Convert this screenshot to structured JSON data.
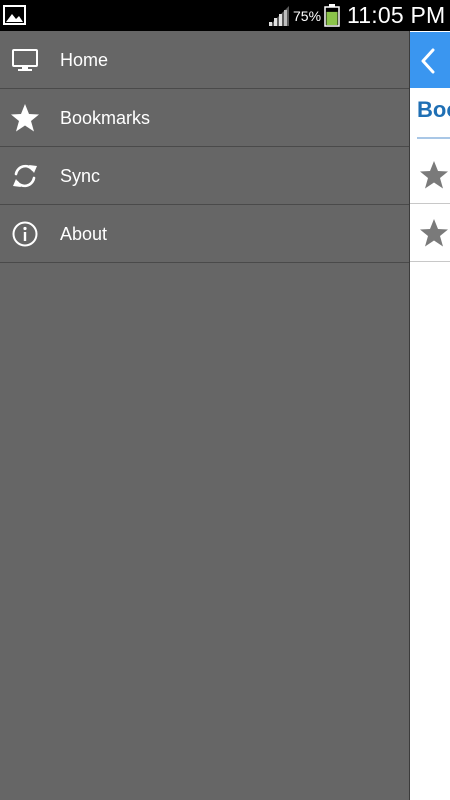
{
  "status_bar": {
    "battery_percent": "75%",
    "time": "11:05 PM",
    "left_icon": "image-icon",
    "signal_icon": "signal-icon",
    "battery_icon": "battery-icon",
    "battery_level": 0.75,
    "battery_color": "#8bc34a"
  },
  "drawer": {
    "background": "#666666",
    "items": [
      {
        "label": "Home",
        "icon": "monitor-icon"
      },
      {
        "label": "Bookmarks",
        "icon": "star-icon"
      },
      {
        "label": "Sync",
        "icon": "sync-icon"
      },
      {
        "label": "About",
        "icon": "info-icon"
      }
    ]
  },
  "main": {
    "header_color": "#3a96f0",
    "back_icon": "chevron-left-icon",
    "title": "Bookmarks",
    "rows": [
      {
        "icon": "star-icon"
      },
      {
        "icon": "star-icon"
      }
    ]
  }
}
